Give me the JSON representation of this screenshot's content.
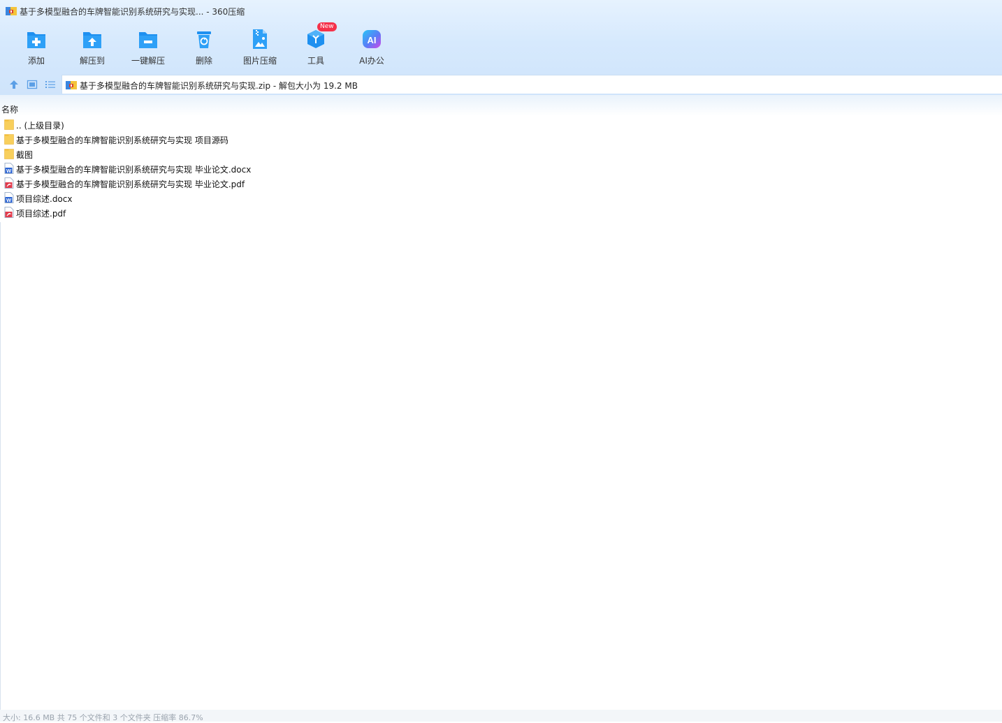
{
  "window": {
    "title": "基于多模型融合的车牌智能识别系统研究与实现... - 360压缩",
    "app_icon": "archive-360-icon"
  },
  "toolbar": {
    "buttons": [
      {
        "label": "添加",
        "icon": "add-folder-icon"
      },
      {
        "label": "解压到",
        "icon": "extract-to-folder-icon"
      },
      {
        "label": "一键解压",
        "icon": "one-click-extract-icon"
      },
      {
        "label": "删除",
        "icon": "recycle-bin-icon"
      },
      {
        "label": "图片压缩",
        "icon": "image-zip-icon"
      },
      {
        "label": "工具",
        "icon": "tools-cube-icon",
        "badge": "New"
      },
      {
        "label": "AI办公",
        "icon": "ai-office-icon"
      }
    ]
  },
  "address_bar": {
    "path": "基于多模型融合的车牌智能识别系统研究与实现.zip - 解包大小为 19.2 MB"
  },
  "list": {
    "column_name": "名称",
    "items": [
      {
        "name": ".. (上级目录)",
        "type": "folder"
      },
      {
        "name": "基于多模型融合的车牌智能识别系统研究与实现 项目源码",
        "type": "folder"
      },
      {
        "name": "截图",
        "type": "folder"
      },
      {
        "name": "基于多模型融合的车牌智能识别系统研究与实现 毕业论文.docx",
        "type": "docx"
      },
      {
        "name": "基于多模型融合的车牌智能识别系统研究与实现 毕业论文.pdf",
        "type": "pdf"
      },
      {
        "name": "项目综述.docx",
        "type": "docx"
      },
      {
        "name": "项目综述.pdf",
        "type": "pdf"
      }
    ]
  },
  "status": {
    "text": "大小: 16.6 MB 共 75 个文件和 3 个文件夹 压缩率 86.7%"
  },
  "colors": {
    "accent": "#1e90f0",
    "badge": "#f5314a",
    "folder": "#f8cf5c",
    "word": "#2b64d4",
    "pdf": "#e23b4c"
  }
}
